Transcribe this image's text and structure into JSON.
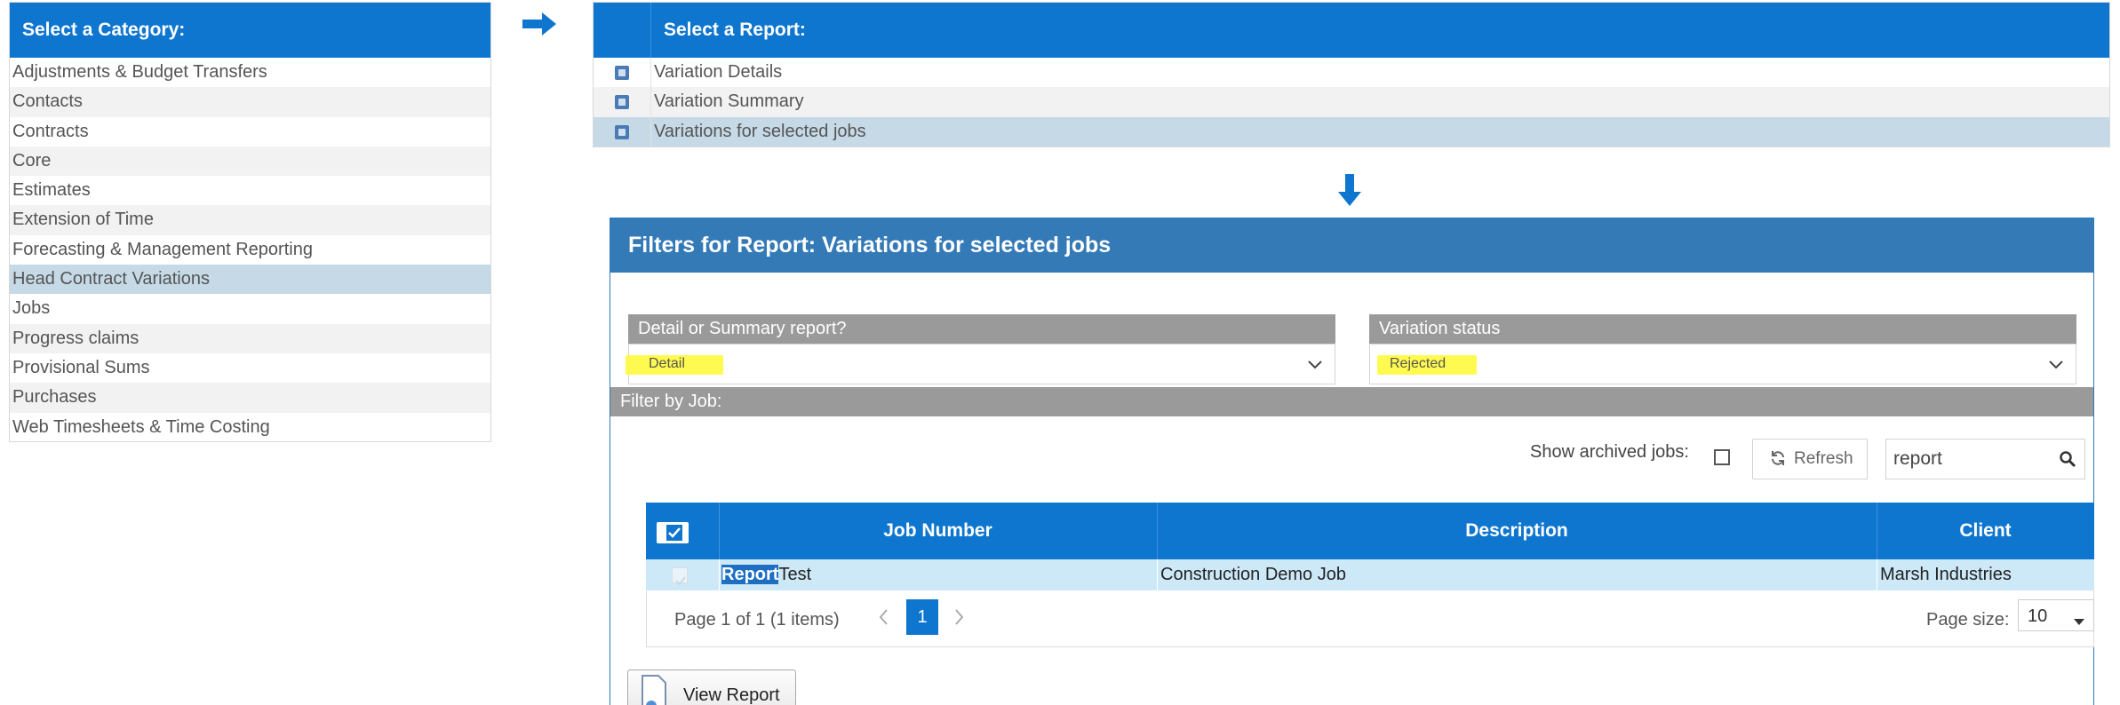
{
  "category_panel": {
    "title": "Select a Category:",
    "items": [
      {
        "label": "Adjustments & Budget Transfers"
      },
      {
        "label": "Contacts"
      },
      {
        "label": "Contracts"
      },
      {
        "label": "Core"
      },
      {
        "label": "Estimates"
      },
      {
        "label": "Extension of Time"
      },
      {
        "label": "Forecasting & Management Reporting"
      },
      {
        "label": "Head Contract Variations"
      },
      {
        "label": "Jobs"
      },
      {
        "label": "Progress claims"
      },
      {
        "label": "Provisional Sums"
      },
      {
        "label": "Purchases"
      },
      {
        "label": "Web Timesheets & Time Costing"
      }
    ],
    "selected_index": 7
  },
  "report_panel": {
    "title": "Select a Report:",
    "items": [
      {
        "label": "Variation Details",
        "icon": "report-icon"
      },
      {
        "label": "Variation Summary",
        "icon": "report-icon"
      },
      {
        "label": "Variations for selected jobs",
        "icon": "report-icon"
      }
    ],
    "selected_index": 2
  },
  "filters": {
    "title": "Filters for Report: Variations for selected jobs",
    "detail_label": "Detail or Summary report?",
    "detail_value": "Detail",
    "status_label": "Variation status",
    "status_value": "Rejected",
    "filter_by_job": "Filter by Job:",
    "show_archived_label": "Show archived jobs:",
    "refresh_label": "Refresh",
    "search_value": "report"
  },
  "grid": {
    "columns": [
      "Job Number",
      "Description",
      "Client"
    ],
    "rows": [
      {
        "job_highlight": "Report",
        "job_rest": "Test",
        "description": "Construction Demo Job",
        "client": "Marsh Industries"
      }
    ],
    "pager_text": "Page 1 of 1 (1 items)",
    "current_page": "1",
    "page_size_label": "Page size:",
    "page_size_value": "10"
  },
  "view_report_label": "View Report",
  "colors": {
    "accent": "#0e76cf",
    "panel_header": "#337ab7",
    "selected": "#c6d9e6",
    "highlight": "#fff93c"
  }
}
